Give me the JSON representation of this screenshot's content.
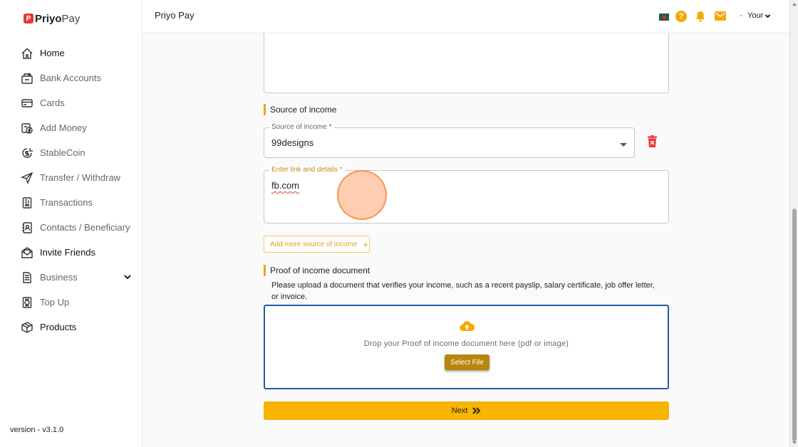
{
  "app": {
    "logo_bold": "Priyo",
    "logo_light": "Pay",
    "logo_mark": "P",
    "version": "version - v3.1.0"
  },
  "header": {
    "title": "Priyo Pay",
    "help_glyph": "?",
    "user_label": "Your"
  },
  "sidebar": {
    "items": [
      {
        "label": "Home",
        "icon": "home-icon"
      },
      {
        "label": "Bank Accounts",
        "icon": "bank-icon"
      },
      {
        "label": "Cards",
        "icon": "card-icon"
      },
      {
        "label": "Add Money",
        "icon": "add-money-icon"
      },
      {
        "label": "StableCoin",
        "icon": "coin-icon"
      },
      {
        "label": "Transfer / Withdraw",
        "icon": "send-icon"
      },
      {
        "label": "Transactions",
        "icon": "receipt-icon"
      },
      {
        "label": "Contacts / Beneficiary",
        "icon": "contacts-icon"
      },
      {
        "label": "Invite Friends",
        "icon": "invite-icon"
      },
      {
        "label": "Business",
        "icon": "business-icon"
      },
      {
        "label": "Top Up",
        "icon": "topup-icon"
      },
      {
        "label": "Products",
        "icon": "products-icon"
      }
    ]
  },
  "form": {
    "source_section_title": "Source of income",
    "source_select": {
      "label": "Source of income *",
      "value": "99designs"
    },
    "link_field": {
      "label": "Enter link and details *",
      "value": "fb.com"
    },
    "add_more_label": "Add more source of income",
    "add_more_glyph": "+",
    "proof_section_title": "Proof of income document",
    "proof_description": "Please upload a document that verifies your income, such as a recent payslip, salary certificate, job offer letter, or invoice.",
    "drop_text": "Drop your Proof of income document here (pdf or image)",
    "select_file_label": "Select File",
    "next_label": "Next"
  },
  "colors": {
    "accent": "#f8b400",
    "section_bar": "#f6a313",
    "dropzone_border": "#1f5ea8",
    "delete": "#e53935"
  }
}
